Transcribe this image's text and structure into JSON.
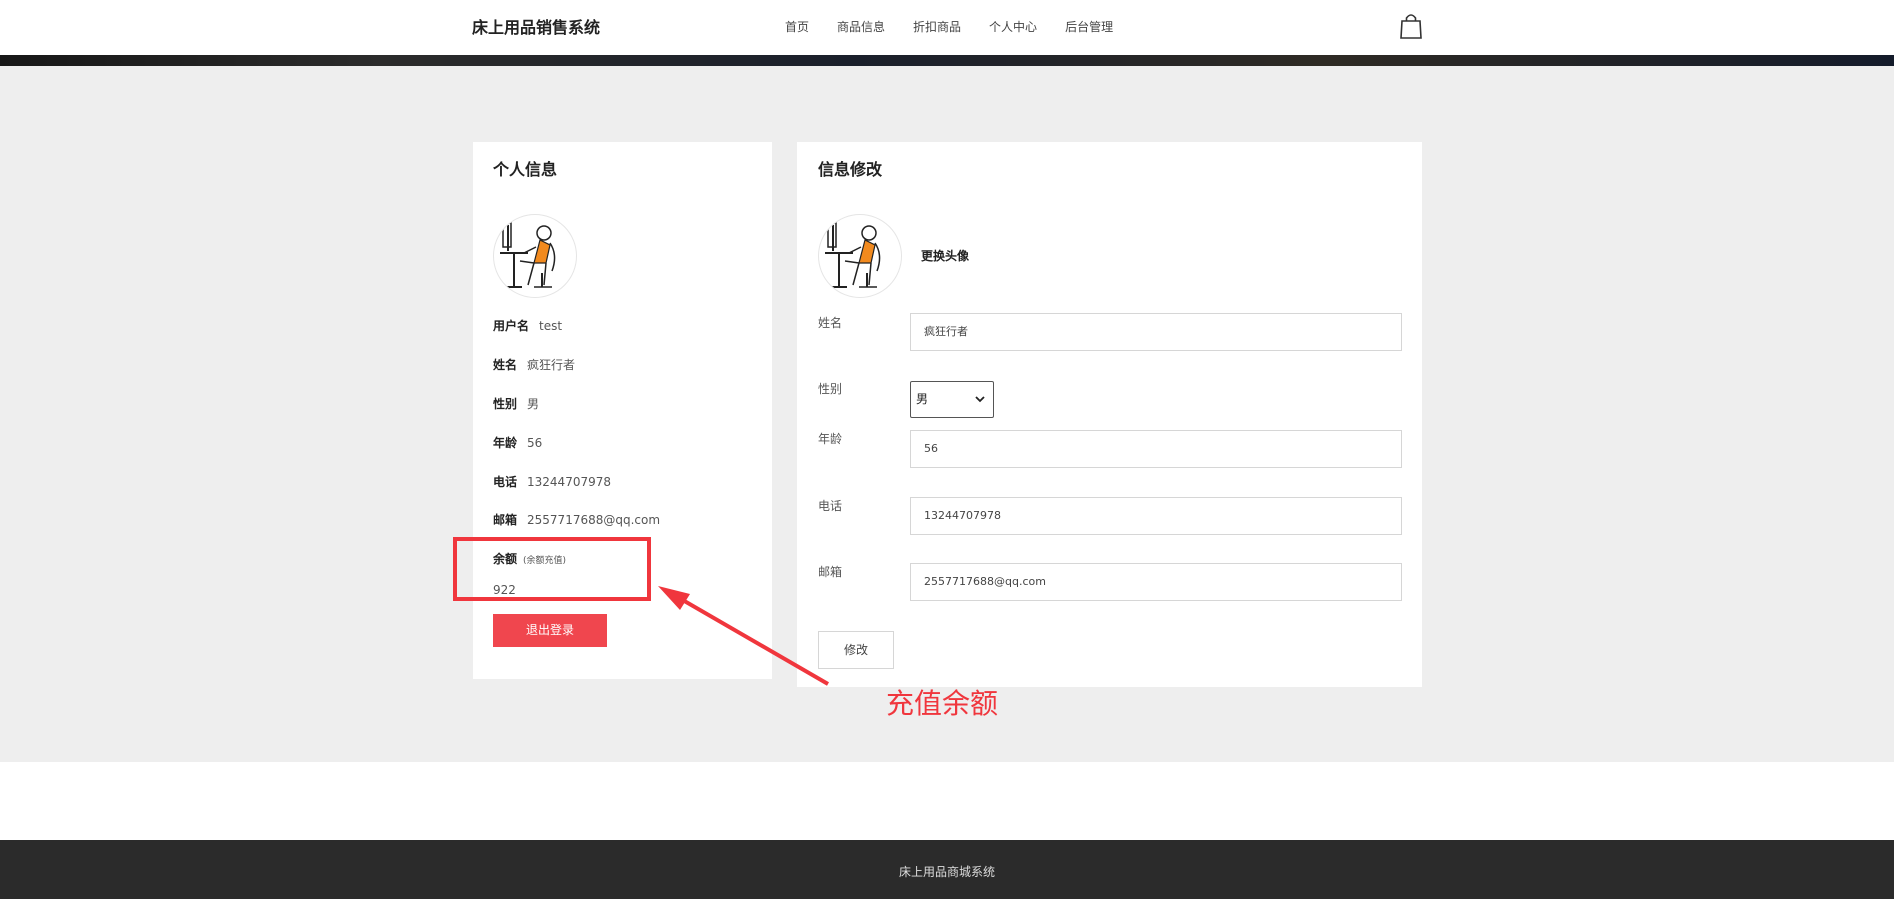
{
  "header": {
    "brand": "床上用品销售系统",
    "nav": [
      "首页",
      "商品信息",
      "折扣商品",
      "个人中心",
      "后台管理"
    ]
  },
  "profile": {
    "title": "个人信息",
    "rows": [
      {
        "label": "用户名",
        "value": "test"
      },
      {
        "label": "姓名",
        "value": "疯狂行者"
      },
      {
        "label": "性别",
        "value": "男"
      },
      {
        "label": "年龄",
        "value": "56"
      },
      {
        "label": "电话",
        "value": "13244707978"
      },
      {
        "label": "邮箱",
        "value": "2557717688@qq.com"
      }
    ],
    "balance_label": "余额",
    "recharge_link": "(余额充值)",
    "balance_value": "922",
    "logout_label": "退出登录"
  },
  "edit": {
    "title": "信息修改",
    "change_avatar": "更换头像",
    "fields": {
      "name": {
        "label": "姓名",
        "value": "疯狂行者"
      },
      "gender": {
        "label": "性别",
        "value": "男"
      },
      "age": {
        "label": "年龄",
        "value": "56"
      },
      "phone": {
        "label": "电话",
        "value": "13244707978"
      },
      "email": {
        "label": "邮箱",
        "value": "2557717688@qq.com"
      }
    },
    "submit_label": "修改"
  },
  "annotation": {
    "text": "充值余额",
    "color": "#f0363d"
  },
  "footer": {
    "text": "床上用品商城系统"
  },
  "colors": {
    "accent": "#f0464e",
    "page_bg": "#eeeeee",
    "footer_bg": "#2b2b2b"
  },
  "icons": {
    "bag": "shopping-bag-icon",
    "avatar": "avatar-image",
    "select_arrow": "chevron-down-icon"
  }
}
